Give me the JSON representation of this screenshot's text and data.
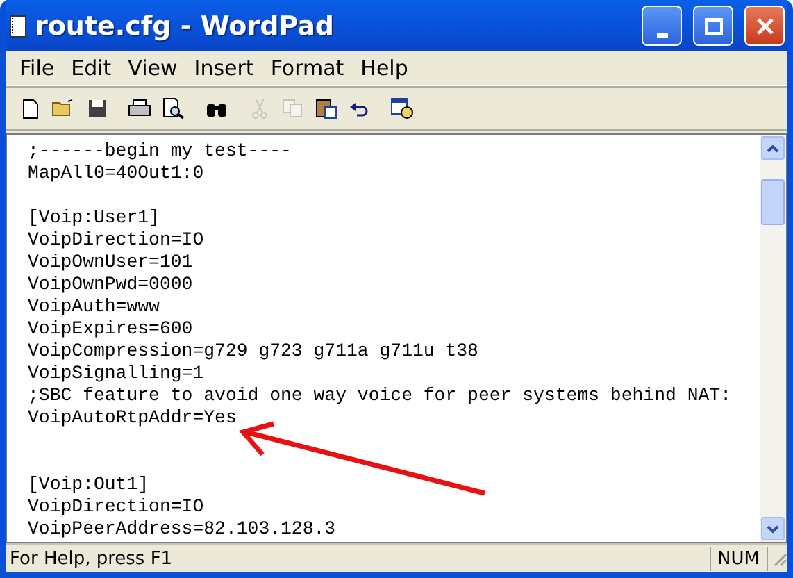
{
  "window": {
    "title": "route.cfg - WordPad",
    "controls": [
      {
        "kind": "minimize"
      },
      {
        "kind": "maximize"
      },
      {
        "kind": "close"
      }
    ]
  },
  "menu": [
    {
      "label": "File"
    },
    {
      "label": "Edit"
    },
    {
      "label": "View"
    },
    {
      "label": "Insert"
    },
    {
      "label": "Format"
    },
    {
      "label": "Help"
    }
  ],
  "toolbar": [
    {
      "kind": "new",
      "disabled": false
    },
    {
      "kind": "open",
      "disabled": false
    },
    {
      "kind": "save",
      "disabled": false
    },
    {
      "kind": "sep"
    },
    {
      "kind": "print",
      "disabled": false
    },
    {
      "kind": "preview",
      "disabled": false
    },
    {
      "kind": "sep"
    },
    {
      "kind": "find",
      "disabled": false
    },
    {
      "kind": "sep"
    },
    {
      "kind": "cut",
      "disabled": true
    },
    {
      "kind": "copy",
      "disabled": true
    },
    {
      "kind": "paste",
      "disabled": false
    },
    {
      "kind": "undo",
      "disabled": false
    },
    {
      "kind": "sep"
    },
    {
      "kind": "datetime",
      "disabled": false
    }
  ],
  "document": {
    "lines": [
      {
        "kind": "text",
        "text": ";------begin my test----"
      },
      {
        "kind": "text",
        "text": "MapAll0=40Out1:0"
      },
      {
        "kind": "blank"
      },
      {
        "kind": "text",
        "text": "[Voip:User1]"
      },
      {
        "kind": "text",
        "text": "VoipDirection=IO"
      },
      {
        "kind": "text",
        "text": "VoipOwnUser=101"
      },
      {
        "kind": "text",
        "text": "VoipOwnPwd=0000"
      },
      {
        "kind": "text",
        "text": "VoipAuth=www"
      },
      {
        "kind": "text",
        "text": "VoipExpires=600"
      },
      {
        "kind": "text",
        "text": "VoipCompression=g729 g723 g711a g711u t38"
      },
      {
        "kind": "text",
        "text": "VoipSignalling=1"
      },
      {
        "kind": "text",
        "text": ";SBC feature to avoid one way voice for peer systems behind NAT:"
      },
      {
        "kind": "text",
        "text": "VoipAutoRtpAddr=Yes"
      },
      {
        "kind": "blank"
      },
      {
        "kind": "blank"
      },
      {
        "kind": "text",
        "text": "[Voip:Out1]"
      },
      {
        "kind": "text",
        "text": "VoipDirection=IO"
      },
      {
        "kind": "text",
        "text": "VoipPeerAddress=82.103.128.3"
      }
    ]
  },
  "status_bar": {
    "text": "For Help, press F1",
    "panels": [
      "NUM"
    ]
  }
}
